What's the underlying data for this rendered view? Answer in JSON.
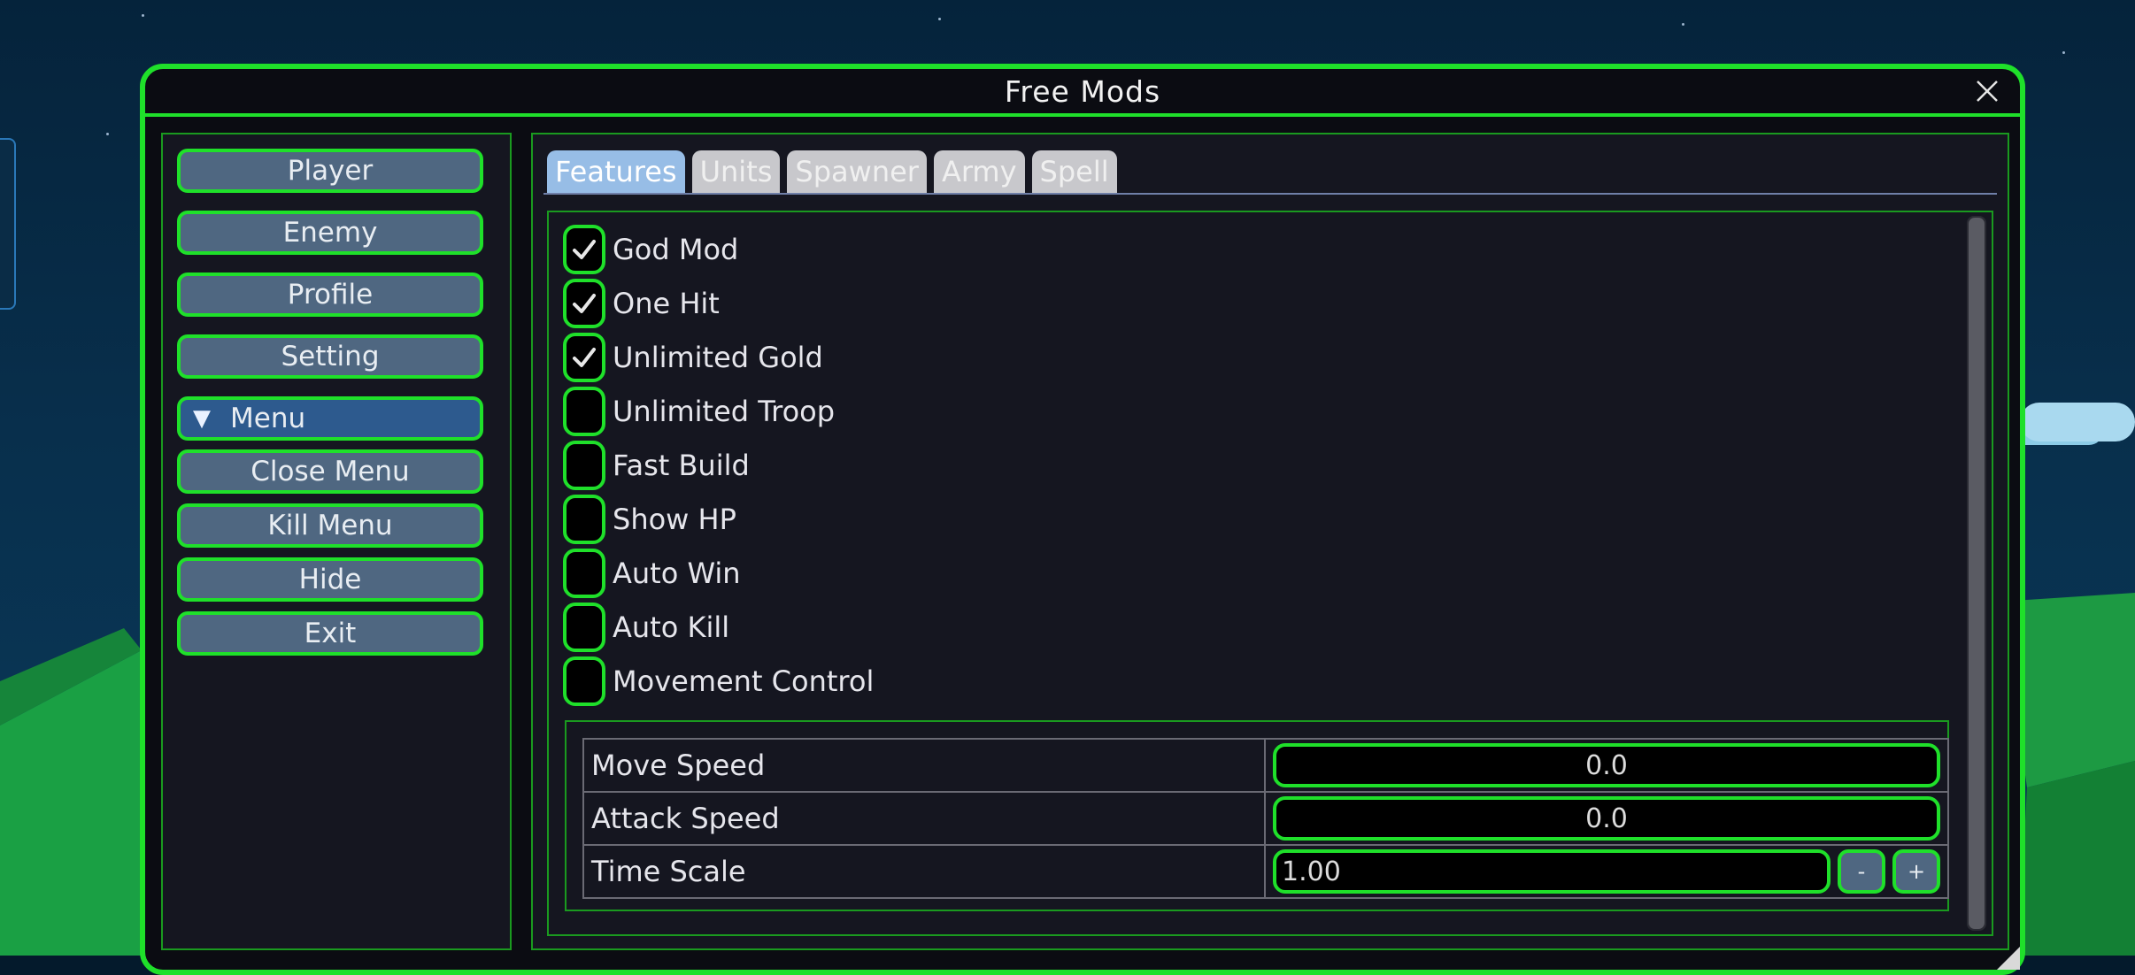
{
  "window": {
    "title": "Free Mods"
  },
  "sidebar": {
    "items": [
      {
        "label": "Player"
      },
      {
        "label": "Enemy"
      },
      {
        "label": "Profile"
      },
      {
        "label": "Setting"
      },
      {
        "label": "Menu",
        "icon": "triangle-down-icon",
        "expanded": true
      },
      {
        "label": "Close Menu"
      },
      {
        "label": "Kill Menu"
      },
      {
        "label": "Hide"
      },
      {
        "label": "Exit"
      }
    ]
  },
  "tabs": [
    {
      "label": "Features",
      "active": true
    },
    {
      "label": "Units",
      "active": false
    },
    {
      "label": "Spawner",
      "active": false
    },
    {
      "label": "Army",
      "active": false
    },
    {
      "label": "Spell",
      "active": false
    }
  ],
  "features": [
    {
      "label": "God Mod",
      "checked": true
    },
    {
      "label": "One Hit",
      "checked": true
    },
    {
      "label": "Unlimited Gold",
      "checked": true
    },
    {
      "label": "Unlimited Troop",
      "checked": false
    },
    {
      "label": "Fast Build",
      "checked": false
    },
    {
      "label": "Show HP",
      "checked": false
    },
    {
      "label": "Auto Win",
      "checked": false
    },
    {
      "label": "Auto Kill",
      "checked": false
    },
    {
      "label": "Movement Control",
      "checked": false
    }
  ],
  "settings": {
    "move_speed": {
      "label": "Move Speed",
      "value": "0.0"
    },
    "attack_speed": {
      "label": "Attack Speed",
      "value": "0.0"
    },
    "time_scale": {
      "label": "Time Scale",
      "value": "1.00",
      "minus_label": "-",
      "plus_label": "+"
    }
  },
  "colors": {
    "accent_green": "#1fe02a",
    "button_fill": "#4f6781",
    "menu_fill": "#2d5a8e",
    "panel_bg": "#151620",
    "active_tab": "#97bde6",
    "inactive_tab": "#c8c8cc"
  }
}
